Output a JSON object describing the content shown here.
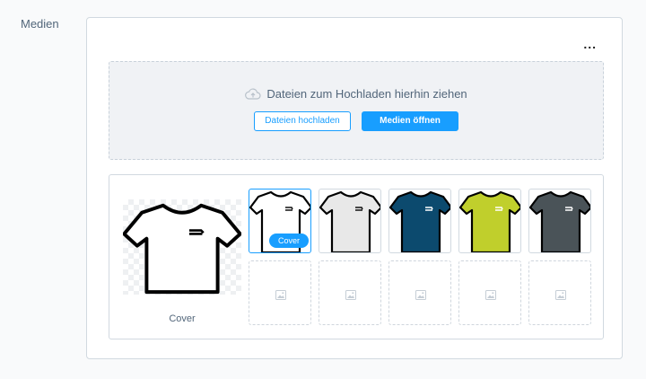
{
  "section_label": "Medien",
  "more_menu": "...",
  "dropzone": {
    "text": "Dateien zum Hochladen hierhin ziehen",
    "upload_button": "Dateien hochladen",
    "open_media_button": "Medien öffnen"
  },
  "gallery": {
    "cover_caption": "Cover",
    "cover_badge": "Cover",
    "thumbnails": [
      {
        "color": "#ffffff",
        "logo": "#111111",
        "selected": true
      },
      {
        "color": "#e8e8e8",
        "logo": "#111111",
        "selected": false
      },
      {
        "color": "#0c4a6e",
        "logo": "#ffffff",
        "selected": false
      },
      {
        "color": "#c0cf2c",
        "logo": "#ffffff",
        "selected": false
      },
      {
        "color": "#4a5358",
        "logo": "#ffffff",
        "selected": false
      }
    ],
    "empty_slot_icon": "image-placeholder-icon"
  },
  "colors": {
    "accent": "#189eff",
    "cover_shirt": "#ffffff"
  }
}
